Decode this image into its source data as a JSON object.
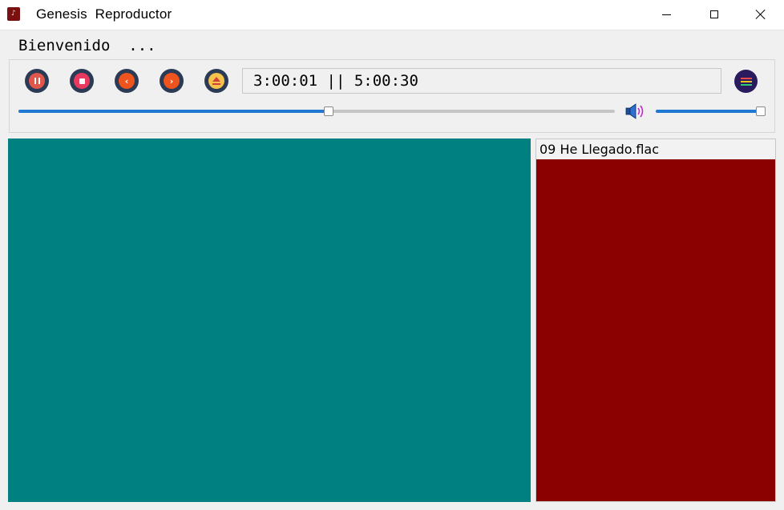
{
  "window": {
    "title": "Genesis  Reproductor",
    "icon": "app-logo-icon"
  },
  "welcome_text": "Bienvenido  ...",
  "controls": {
    "buttons": [
      {
        "name": "pause",
        "icon": "pause-icon",
        "color": "#e2574c"
      },
      {
        "name": "stop",
        "icon": "stop-icon",
        "color": "#e83a5e"
      },
      {
        "name": "previous",
        "icon": "chevron-left-icon",
        "color": "#f0541e"
      },
      {
        "name": "next",
        "icon": "chevron-right-icon",
        "color": "#f0541e"
      },
      {
        "name": "eject",
        "icon": "eject-icon",
        "color": "#f5c24a"
      }
    ],
    "time_display": "3:00:01 || 5:00:30",
    "menu_icon": "hamburger-menu-icon",
    "seek_progress": 0.52,
    "volume_level": 1.0
  },
  "colors": {
    "video_bg": "#008080",
    "playlist_bg": "#8b0000",
    "slider_accent": "#1f78d1"
  },
  "playlist": {
    "items": [
      "09 He Llegado.flac"
    ]
  }
}
